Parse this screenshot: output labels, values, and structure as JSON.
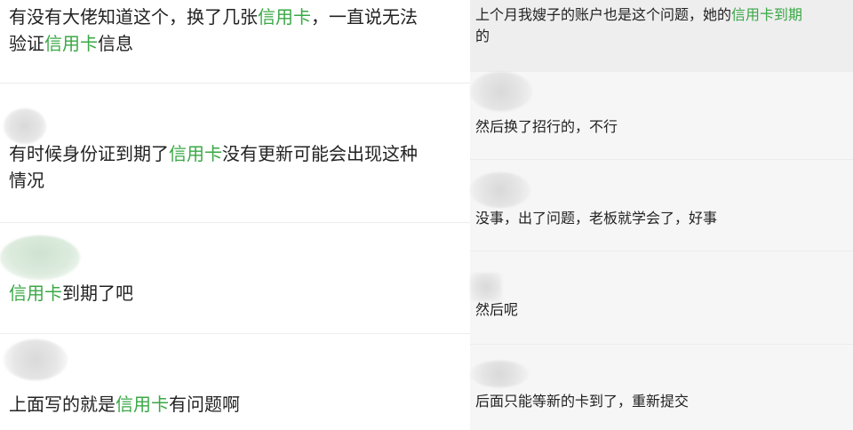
{
  "left_comments": [
    {
      "parts": [
        "有没有大佬知道这个，换了几张",
        "信用卡",
        "，一直说无法"
      ],
      "line2": [
        "验证",
        "信用卡",
        "信息"
      ]
    },
    {
      "parts": [
        "有时候身份证到期了",
        "信用卡",
        "没有更新可能会出现这种"
      ],
      "line2": [
        "情况"
      ]
    },
    {
      "parts": [
        "",
        "信用卡",
        "到期了吧"
      ]
    },
    {
      "parts": [
        "上面写的就是",
        "信用卡",
        "有问题啊"
      ]
    }
  ],
  "right_comments": [
    {
      "parts": [
        "上个月我嫂子的账户也是这个问题，她的",
        "信用卡到期",
        ""
      ],
      "line2": [
        "的"
      ]
    },
    {
      "text": "然后换了招行的，不行"
    },
    {
      "text": "没事，出了问题，老板就学会了，好事"
    },
    {
      "text": "然后呢"
    },
    {
      "text": "后面只能等新的卡到了，重新提交"
    }
  ],
  "colors": {
    "highlight": "#3aa845",
    "text": "#222222"
  }
}
